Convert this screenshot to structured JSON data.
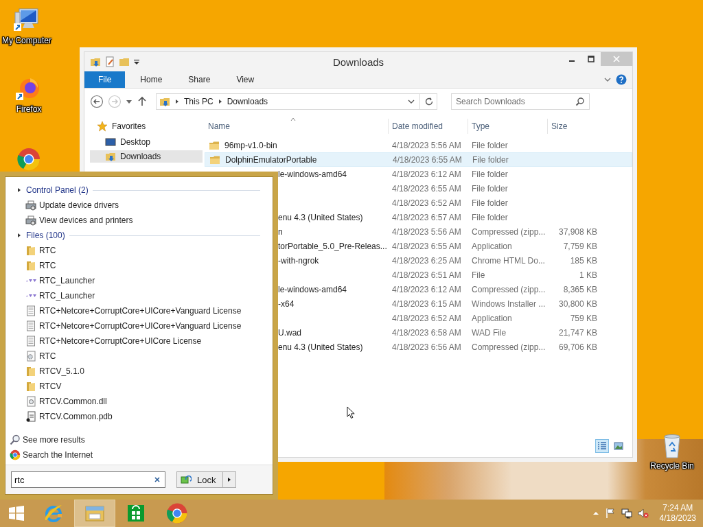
{
  "desktop_icons": [
    {
      "label": "My Computer",
      "kind": "computer"
    },
    {
      "label": "Firefox",
      "kind": "firefox"
    },
    {
      "kind": "chrome"
    },
    {
      "label": "Recycle Bin",
      "kind": "recycle"
    }
  ],
  "explorer": {
    "title": "Downloads",
    "ribbon_tabs": [
      {
        "label": "File",
        "kind": "file"
      },
      {
        "label": "Home",
        "kind": "tab"
      },
      {
        "label": "Share",
        "kind": "tab"
      },
      {
        "label": "View",
        "kind": "tab"
      }
    ],
    "nav_buttons": [
      {
        "kind": "back",
        "disabled": false
      },
      {
        "kind": "forward",
        "disabled": true
      },
      {
        "kind": "recent",
        "disabled": false
      },
      {
        "kind": "up",
        "disabled": false
      }
    ],
    "address": {
      "path": [
        "This PC",
        "Downloads"
      ]
    },
    "search": {
      "placeholder": "Search Downloads"
    },
    "nav_pane": [
      {
        "label": "Favorites",
        "kind": "favorites",
        "selected": false
      },
      {
        "label": "Desktop",
        "kind": "desktop",
        "selected": false
      },
      {
        "label": "Downloads",
        "kind": "downloads",
        "selected": true
      }
    ],
    "columns": [
      "Name",
      "Date modified",
      "Type",
      "Size"
    ],
    "rows": [
      {
        "name": "96mp-v1.0-bin",
        "name_clipped": false,
        "date": "4/18/2023 5:56 AM",
        "type": "File folder",
        "highlighted": false
      },
      {
        "name": "DolphinEmulatorPortable",
        "name_clipped": false,
        "date": "4/18/2023 6:55 AM",
        "type": "File folder",
        "highlighted": true
      },
      {
        "name": "le-windows-amd64",
        "name_clipped": true,
        "date": "4/18/2023 6:12 AM",
        "type": "File folder",
        "highlighted": false
      },
      {
        "date": "4/18/2023 6:55 AM",
        "type": "File folder",
        "highlighted": false
      },
      {
        "date": "4/18/2023 6:52 AM",
        "type": "File folder",
        "highlighted": false
      },
      {
        "name": "enu 4.3 (United States)",
        "name_clipped": true,
        "date": "4/18/2023 6:57 AM",
        "type": "File folder",
        "highlighted": false
      },
      {
        "name": "n",
        "name_clipped": true,
        "date": "4/18/2023 5:56 AM",
        "type": "Compressed (zipp...",
        "size": "37,908 KB",
        "highlighted": false
      },
      {
        "name": "torPortable_5.0_Pre-Releas...",
        "name_clipped": true,
        "date": "4/18/2023 6:55 AM",
        "type": "Application",
        "size": "7,759 KB",
        "highlighted": false
      },
      {
        "name": "-with-ngrok",
        "name_clipped": true,
        "date": "4/18/2023 6:25 AM",
        "type": "Chrome HTML Do...",
        "size": "185 KB",
        "highlighted": false
      },
      {
        "date": "4/18/2023 6:51 AM",
        "type": "File",
        "size": "1 KB",
        "highlighted": false
      },
      {
        "name": "le-windows-amd64",
        "name_clipped": true,
        "date": "4/18/2023 6:12 AM",
        "type": "Compressed (zipp...",
        "size": "8,365 KB",
        "highlighted": false
      },
      {
        "name": "-x64",
        "name_clipped": true,
        "date": "4/18/2023 6:15 AM",
        "type": "Windows Installer ...",
        "size": "30,800 KB",
        "highlighted": false
      },
      {
        "date": "4/18/2023 6:52 AM",
        "type": "Application",
        "size": "759 KB",
        "highlighted": false
      },
      {
        "name": "U.wad",
        "name_clipped": true,
        "date": "4/18/2023 6:58 AM",
        "type": "WAD File",
        "size": "21,747 KB",
        "highlighted": false
      },
      {
        "name": "enu 4.3 (United States)",
        "name_clipped": true,
        "date": "4/18/2023 6:56 AM",
        "type": "Compressed (zipp...",
        "size": "69,706 KB",
        "highlighted": false
      }
    ],
    "view_buttons": [
      {
        "kind": "details",
        "selected": true
      },
      {
        "kind": "large",
        "selected": false
      }
    ]
  },
  "start_menu": {
    "groups": [
      {
        "title": "Control Panel (2)",
        "items": [
          {
            "label": "Update device drivers",
            "kind": "device"
          },
          {
            "label": "View devices and printers",
            "kind": "device"
          }
        ]
      },
      {
        "title": "Files (100)",
        "items": [
          {
            "label": "RTC",
            "kind": "folder"
          },
          {
            "label": "RTC",
            "kind": "folder"
          },
          {
            "label": "RTC_Launcher",
            "kind": "launcher"
          },
          {
            "label": "RTC_Launcher",
            "kind": "launcher"
          },
          {
            "label": "RTC+Netcore+CorruptCore+UICore+Vanguard License",
            "kind": "document"
          },
          {
            "label": "RTC+Netcore+CorruptCore+UICore+Vanguard License",
            "kind": "document"
          },
          {
            "label": "RTC+Netcore+CorruptCore+UICore License",
            "kind": "document"
          },
          {
            "label": "RTC",
            "kind": "config"
          },
          {
            "label": "RTCV_5.1.0",
            "kind": "folder"
          },
          {
            "label": "RTCV",
            "kind": "folder"
          },
          {
            "label": "RTCV.Common.dll",
            "kind": "dll"
          },
          {
            "label": "RTCV.Common.pdb",
            "kind": "pdb"
          }
        ]
      }
    ],
    "links": [
      {
        "label": "See more results",
        "kind": "search"
      },
      {
        "label": "Search the Internet",
        "kind": "chrome"
      }
    ],
    "search": {
      "value": "rtc"
    },
    "power_button": {
      "label": "Lock"
    }
  },
  "taskbar": {
    "apps": [
      {
        "kind": "ie",
        "active": false
      },
      {
        "kind": "explorer",
        "active": true
      },
      {
        "kind": "store",
        "active": false
      },
      {
        "kind": "chrome",
        "active": false
      }
    ],
    "time": "7:24 AM",
    "date": "4/18/2023"
  }
}
